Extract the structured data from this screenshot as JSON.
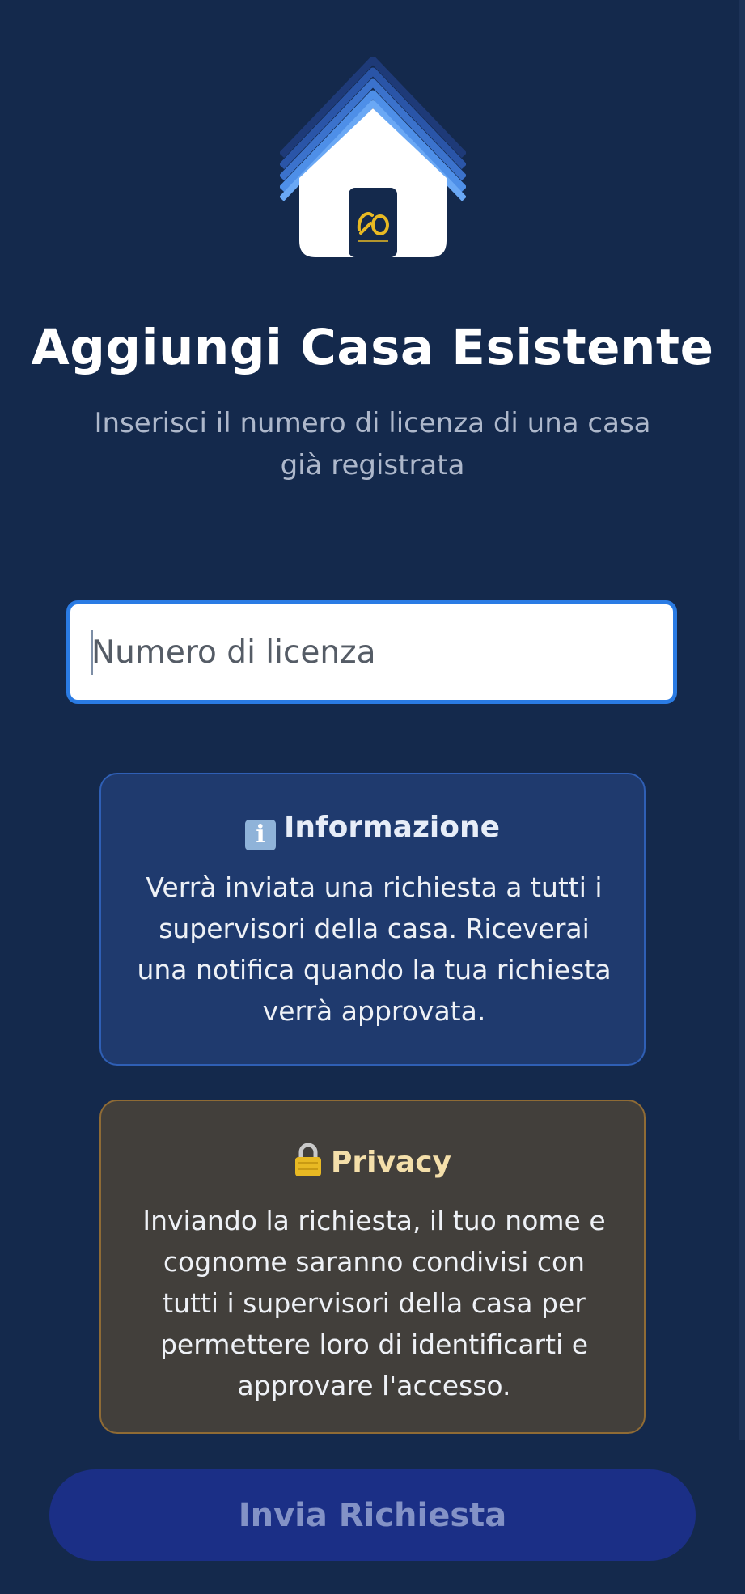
{
  "header": {
    "logo_name": "house-logo",
    "title": "Aggiungi Casa Esistente",
    "subtitle": "Inserisci il numero di licenza di una casa già registrata"
  },
  "form": {
    "license_value": "",
    "license_placeholder": "Numero di licenza"
  },
  "info_card": {
    "icon": "info-icon",
    "icon_glyph": "i",
    "heading": "Informazione",
    "body": "Verrà inviata una richiesta a tutti i supervisori della casa. Riceverai una notifica quando la tua richiesta verrà approvata."
  },
  "privacy_card": {
    "icon": "lock-icon",
    "heading": "Privacy",
    "body": "Inviando la richiesta, il tuo nome e cognome saranno condivisi con tutti i supervisori della casa per permettere loro di identificarti e approvare l'accesso."
  },
  "submit": {
    "label": "Invia Richiesta",
    "enabled": false
  },
  "colors": {
    "background": "#14294c",
    "accent": "#2a7be4",
    "info_card_bg": "#1f3a6e",
    "privacy_card_bg": "#423f3b",
    "privacy_border": "#8f6b35",
    "button_bg": "#1b2f86",
    "button_text": "#8392c6",
    "logo_gold": "#e8b923"
  }
}
